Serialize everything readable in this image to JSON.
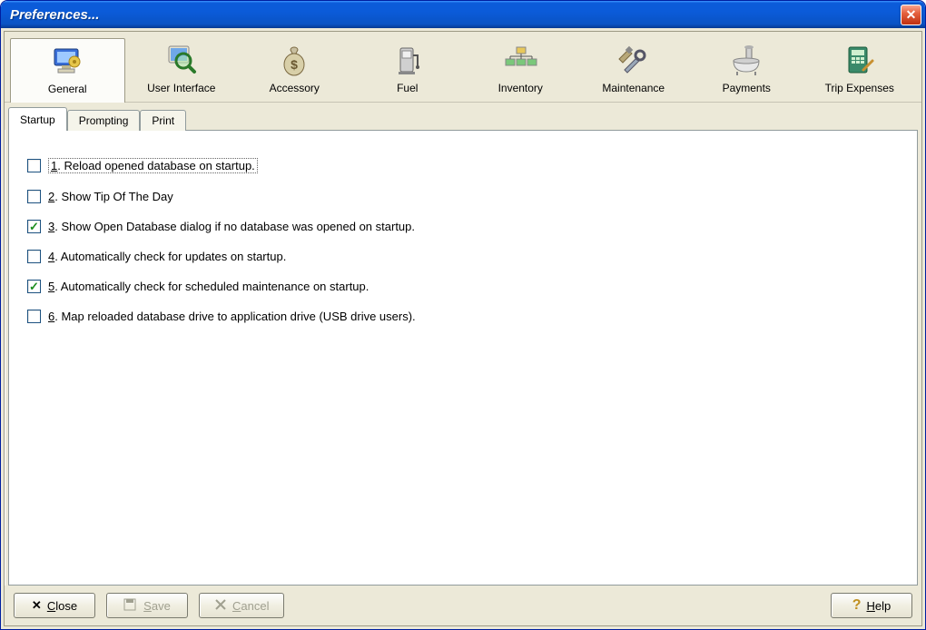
{
  "window": {
    "title": "Preferences..."
  },
  "toolbar": {
    "items": [
      {
        "label": "General",
        "icon": "monitor-gear"
      },
      {
        "label": "User Interface",
        "icon": "screen-magnify"
      },
      {
        "label": "Accessory",
        "icon": "money-bag"
      },
      {
        "label": "Fuel",
        "icon": "fuel-pump"
      },
      {
        "label": "Inventory",
        "icon": "org-chart"
      },
      {
        "label": "Maintenance",
        "icon": "tools"
      },
      {
        "label": "Payments",
        "icon": "bathtub"
      },
      {
        "label": "Trip Expenses",
        "icon": "calculator"
      }
    ],
    "selected": 0
  },
  "tabs": {
    "items": [
      "Startup",
      "Prompting",
      "Print"
    ],
    "active": 0
  },
  "options": [
    {
      "num": "1",
      "text": ". Reload opened database on startup.",
      "checked": false,
      "dotted": true
    },
    {
      "num": "2",
      "text": ". Show Tip Of The Day",
      "checked": false
    },
    {
      "num": "3",
      "text": ". Show Open Database dialog if no database was opened on startup.",
      "checked": true
    },
    {
      "num": "4",
      "text": ". Automatically check for updates on startup.",
      "checked": false
    },
    {
      "num": "5",
      "text": ". Automatically check for scheduled maintenance on startup.",
      "checked": true
    },
    {
      "num": "6",
      "text": ". Map reloaded database drive to application drive (USB drive users).",
      "checked": false
    }
  ],
  "buttons": {
    "close": "Close",
    "save": "Save",
    "cancel": "Cancel",
    "help": "Help"
  }
}
